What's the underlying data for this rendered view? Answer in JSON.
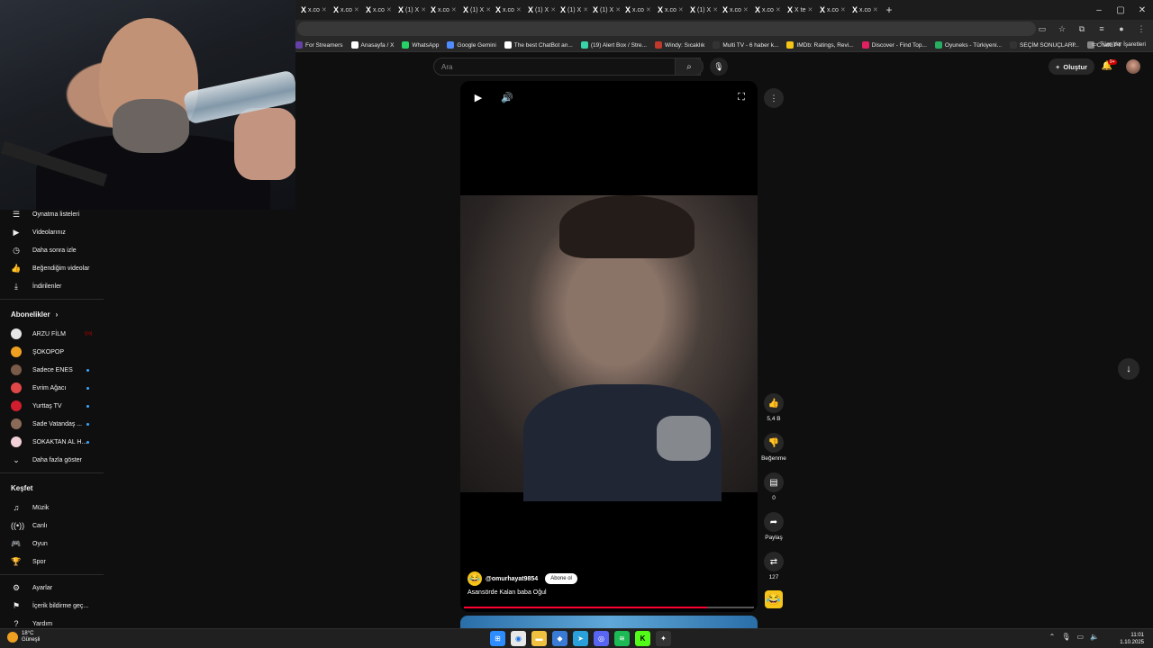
{
  "browser": {
    "tabs": [
      {
        "icon": "X",
        "label": "x.co"
      },
      {
        "icon": "X",
        "label": "x.co"
      },
      {
        "icon": "X",
        "label": "x.co"
      },
      {
        "icon": "X",
        "label": "(1) X"
      },
      {
        "icon": "X",
        "label": "x.co"
      },
      {
        "icon": "X",
        "label": "(1) X"
      },
      {
        "icon": "X",
        "label": "x.co"
      },
      {
        "icon": "X",
        "label": "(1) X"
      },
      {
        "icon": "X",
        "label": "(1) X"
      },
      {
        "icon": "X",
        "label": "(1) X"
      },
      {
        "icon": "X",
        "label": "x.co"
      },
      {
        "icon": "X",
        "label": "x.co"
      },
      {
        "icon": "X",
        "label": "(1) X"
      },
      {
        "icon": "X",
        "label": "x.co"
      },
      {
        "icon": "X",
        "label": "x.co"
      },
      {
        "icon": "X",
        "label": "X te"
      },
      {
        "icon": "X",
        "label": "x.co"
      },
      {
        "icon": "X",
        "label": "x.co"
      }
    ],
    "new_tab": "+",
    "bookmarks": [
      {
        "label": "For Streamers",
        "color": "#6441a5"
      },
      {
        "label": "Anasayfa / X",
        "color": "#ffffff"
      },
      {
        "label": "WhatsApp",
        "color": "#25d366"
      },
      {
        "label": "Google Gemini",
        "color": "#4e8cff"
      },
      {
        "label": "The best ChatBot an...",
        "color": "#ffffff"
      },
      {
        "label": "(19) Alert Box / Stre...",
        "color": "#38d3a8"
      },
      {
        "label": "Windy: Sıcaklık",
        "color": "#c0392b"
      },
      {
        "label": "Multi TV - 6 haber k...",
        "color": "#333333"
      },
      {
        "label": "IMDb: Ratings, Revi...",
        "color": "#f5c518"
      },
      {
        "label": "Discover - Find Top...",
        "color": "#e02060"
      },
      {
        "label": "Oyuneks - Türkiyeni...",
        "color": "#27ae60"
      },
      {
        "label": "SEÇİM SONUÇLARI...",
        "color": "#333333"
      },
      {
        "label": "ChatGPT",
        "color": "#888888"
      }
    ],
    "bookmarks_more": "»",
    "all_bookmarks": "Tüm Yer İşaretleri"
  },
  "masthead": {
    "search_placeholder": "Ara",
    "create_label": "Oluştur",
    "notif_badge": "9+"
  },
  "sidebar": {
    "you_items": [
      {
        "icon": "☰",
        "label": "Oynatma listeleri"
      },
      {
        "icon": "▶",
        "label": "Videolarınız"
      },
      {
        "icon": "◷",
        "label": "Daha sonra izle"
      },
      {
        "icon": "👍",
        "label": "Beğendiğim videolar"
      },
      {
        "icon": "⤓",
        "label": "İndirilenler"
      }
    ],
    "subscriptions_heading": "Abonelikler",
    "subscriptions": [
      {
        "label": "ARZU FİLM",
        "color": "#e6e6e6",
        "indicator": "live"
      },
      {
        "label": "ŞOKOPOP",
        "color": "#f0a020",
        "indicator": ""
      },
      {
        "label": "Sadece ENES",
        "color": "#7a5a48",
        "indicator": "dot"
      },
      {
        "label": "Evrim Ağacı",
        "color": "#e04848",
        "indicator": "dot"
      },
      {
        "label": "Yurttaş TV",
        "color": "#d01e2e",
        "indicator": "dot"
      },
      {
        "label": "Sade Vatandaş ...",
        "color": "#8a6a58",
        "indicator": "dot"
      },
      {
        "label": "SOKAKTAN AL H...",
        "color": "#f2d0d8",
        "indicator": "dot"
      }
    ],
    "show_more": "Daha fazla göster",
    "explore_heading": "Keşfet",
    "explore": [
      {
        "icon": "♫",
        "label": "Müzik"
      },
      {
        "icon": "((•))",
        "label": "Canlı"
      },
      {
        "icon": "🎮",
        "label": "Oyun"
      },
      {
        "icon": "🏆",
        "label": "Spor"
      }
    ],
    "footer": [
      {
        "icon": "⚙",
        "label": "Ayarlar"
      },
      {
        "icon": "⚑",
        "label": "İçerik bildirme geç..."
      },
      {
        "icon": "?",
        "label": "Yardım"
      }
    ]
  },
  "short": {
    "channel": "@omurhayat9854",
    "subscribe": "Abone ol",
    "title": "Asansörde Kalan baba Oğul",
    "progress": 0.84
  },
  "actions": {
    "like_count": "5,4 B",
    "dislike_label": "Beğenme",
    "comment_count": "0",
    "share_label": "Paylaş",
    "remix_count": "127"
  },
  "taskbar": {
    "temperature": "18°C",
    "weather": "Güneşli",
    "apps": [
      {
        "name": "windows",
        "color": "#2d8cff",
        "glyph": "⊞"
      },
      {
        "name": "chrome",
        "color": "#e8e8e8",
        "glyph": "◉"
      },
      {
        "name": "explorer",
        "color": "#f0c040",
        "glyph": "▬"
      },
      {
        "name": "app4",
        "color": "#3a7bd5",
        "glyph": "◆"
      },
      {
        "name": "telegram",
        "color": "#2aa1da",
        "glyph": "➤"
      },
      {
        "name": "discord",
        "color": "#5865f2",
        "glyph": "◎"
      },
      {
        "name": "spotify",
        "color": "#1db954",
        "glyph": "≋"
      },
      {
        "name": "kick",
        "color": "#53fc18",
        "glyph": "K"
      },
      {
        "name": "app9",
        "color": "#333333",
        "glyph": "✦"
      }
    ],
    "time": "11:01",
    "date": "1.10.2025"
  }
}
